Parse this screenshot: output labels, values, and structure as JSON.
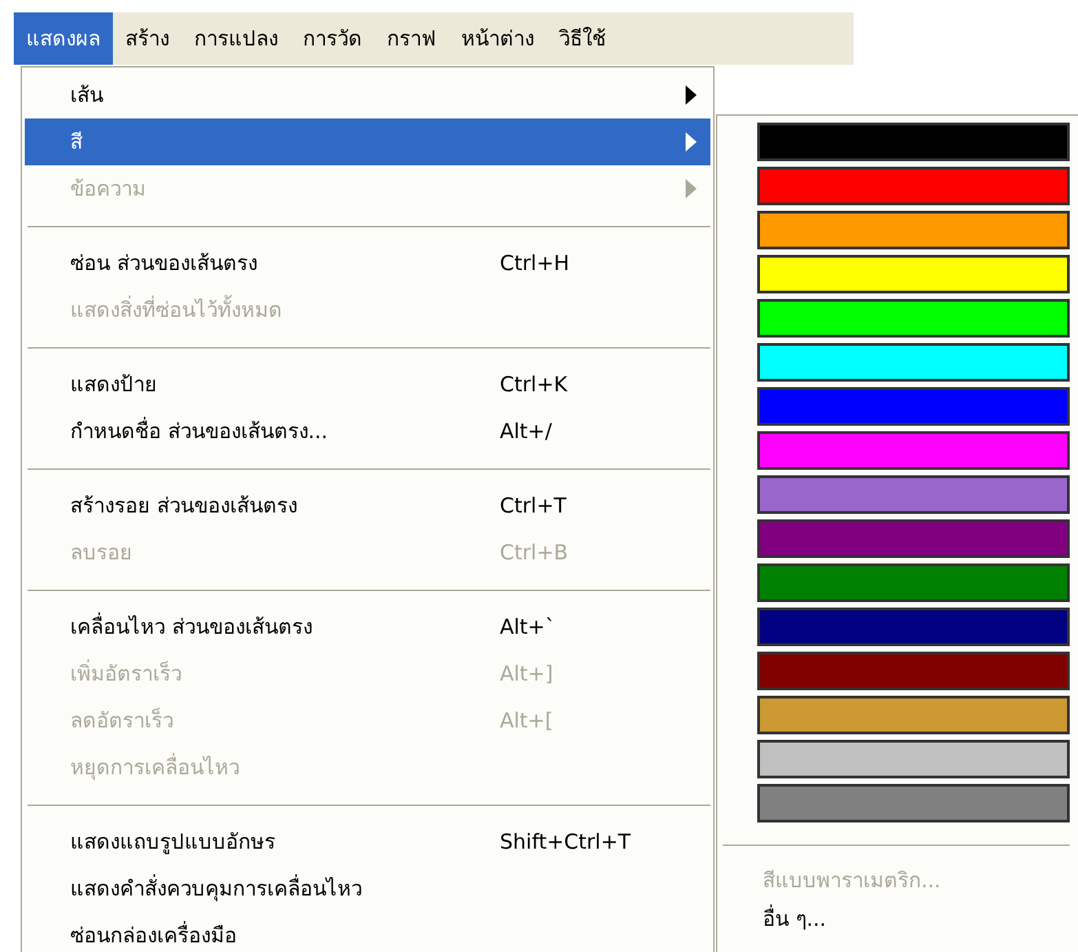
{
  "menubar": [
    {
      "label": "แสดงผล",
      "selected": true
    },
    {
      "label": "สร้าง",
      "selected": false
    },
    {
      "label": "การแปลง",
      "selected": false
    },
    {
      "label": "การวัด",
      "selected": false
    },
    {
      "label": "กราฟ",
      "selected": false
    },
    {
      "label": "หน้าต่าง",
      "selected": false
    },
    {
      "label": "วิธีใช้",
      "selected": false
    }
  ],
  "menu": [
    {
      "kind": "item",
      "label": "เส้น",
      "selected": false,
      "disabled": false,
      "submenu": true
    },
    {
      "kind": "item",
      "label": "สี",
      "selected": true,
      "disabled": false,
      "submenu": true
    },
    {
      "kind": "item",
      "label": "ข้อความ",
      "selected": false,
      "disabled": true,
      "submenu": true
    },
    {
      "kind": "separator"
    },
    {
      "kind": "item",
      "label": "ซ่อน ส่วนของเส้นตรง",
      "shortcut": "Ctrl+H",
      "selected": false,
      "disabled": false
    },
    {
      "kind": "item",
      "label": "แสดงสิ่งที่ซ่อนไว้ทั้งหมด",
      "selected": false,
      "disabled": true
    },
    {
      "kind": "separator"
    },
    {
      "kind": "item",
      "label": "แสดงป้าย",
      "shortcut": "Ctrl+K",
      "selected": false,
      "disabled": false
    },
    {
      "kind": "item",
      "label": "กำหนดชื่อ ส่วนของเส้นตรง...",
      "shortcut": "Alt+/",
      "selected": false,
      "disabled": false
    },
    {
      "kind": "separator"
    },
    {
      "kind": "item",
      "label": "สร้างรอย ส่วนของเส้นตรง",
      "shortcut": "Ctrl+T",
      "selected": false,
      "disabled": false
    },
    {
      "kind": "item",
      "label": "ลบรอย",
      "shortcut": "Ctrl+B",
      "selected": false,
      "disabled": true
    },
    {
      "kind": "separator"
    },
    {
      "kind": "item",
      "label": "เคลื่อนไหว ส่วนของเส้นตรง",
      "shortcut": "Alt+`",
      "selected": false,
      "disabled": false
    },
    {
      "kind": "item",
      "label": "เพิ่มอัตราเร็ว",
      "shortcut": "Alt+]",
      "selected": false,
      "disabled": true
    },
    {
      "kind": "item",
      "label": "ลดอัตราเร็ว",
      "shortcut": "Alt+[",
      "selected": false,
      "disabled": true
    },
    {
      "kind": "item",
      "label": "หยุดการเคลื่อนไหว",
      "selected": false,
      "disabled": true
    },
    {
      "kind": "separator"
    },
    {
      "kind": "item",
      "label": "แสดงแถบรูปแบบอักษร",
      "shortcut": "Shift+Ctrl+T",
      "selected": false,
      "disabled": false
    },
    {
      "kind": "item",
      "label": "แสดงคำสั่งควบคุมการเคลื่อนไหว",
      "selected": false,
      "disabled": false
    },
    {
      "kind": "item",
      "label": "ซ่อนกล่องเครื่องมือ",
      "selected": false,
      "disabled": false
    }
  ],
  "color_submenu": {
    "swatches": [
      {
        "color": "#000000"
      },
      {
        "color": "#ff0000"
      },
      {
        "color": "#ff9900"
      },
      {
        "color": "#ffff00"
      },
      {
        "color": "#00ff00"
      },
      {
        "color": "#00ffff"
      },
      {
        "color": "#0000ff"
      },
      {
        "color": "#ff00ff"
      },
      {
        "color": "#9966cc"
      },
      {
        "color": "#800080"
      },
      {
        "color": "#008000"
      },
      {
        "color": "#000080"
      },
      {
        "color": "#800000"
      },
      {
        "color": "#cc9933"
      },
      {
        "color": "#c0c0c0"
      },
      {
        "color": "#808080"
      }
    ],
    "items": [
      {
        "label": "สีแบบพาราเมตริก...",
        "disabled": true
      },
      {
        "label": "อื่น ๆ...",
        "disabled": false
      }
    ]
  }
}
